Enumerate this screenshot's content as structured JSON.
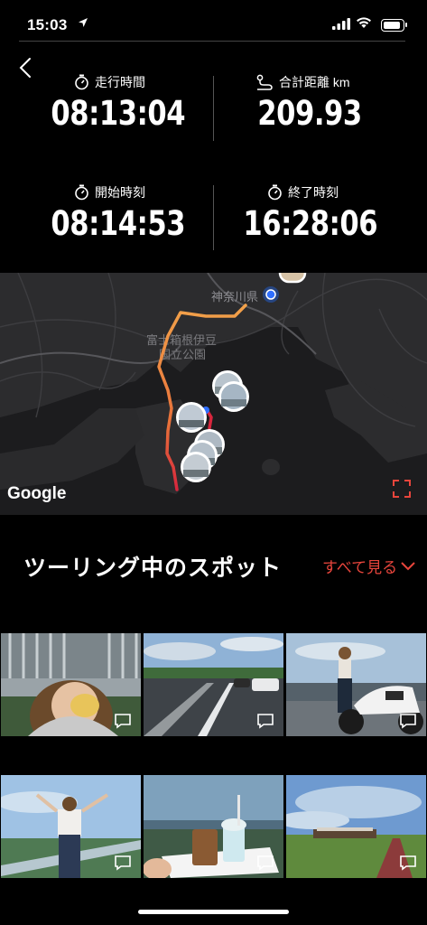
{
  "status_bar": {
    "time": "15:03"
  },
  "stats": {
    "ride_time": {
      "label": "走行時間",
      "value": "08:13:04"
    },
    "distance": {
      "label": "合計距離 km",
      "value": "209.93"
    },
    "start_time": {
      "label": "開始時刻",
      "value": "08:14:53"
    },
    "end_time": {
      "label": "終了時刻",
      "value": "16:28:06"
    }
  },
  "map": {
    "labels": {
      "prefecture": "神奈川県",
      "park_line1": "富士箱根伊豆",
      "park_line2": "国立公園"
    },
    "attribution": "Google",
    "route_colors": {
      "start": "#f2a24a",
      "end": "#d7263d"
    }
  },
  "spots": {
    "title": "ツーリング中のスポット",
    "see_all": "すべて見る",
    "accent": "#e8453c"
  }
}
